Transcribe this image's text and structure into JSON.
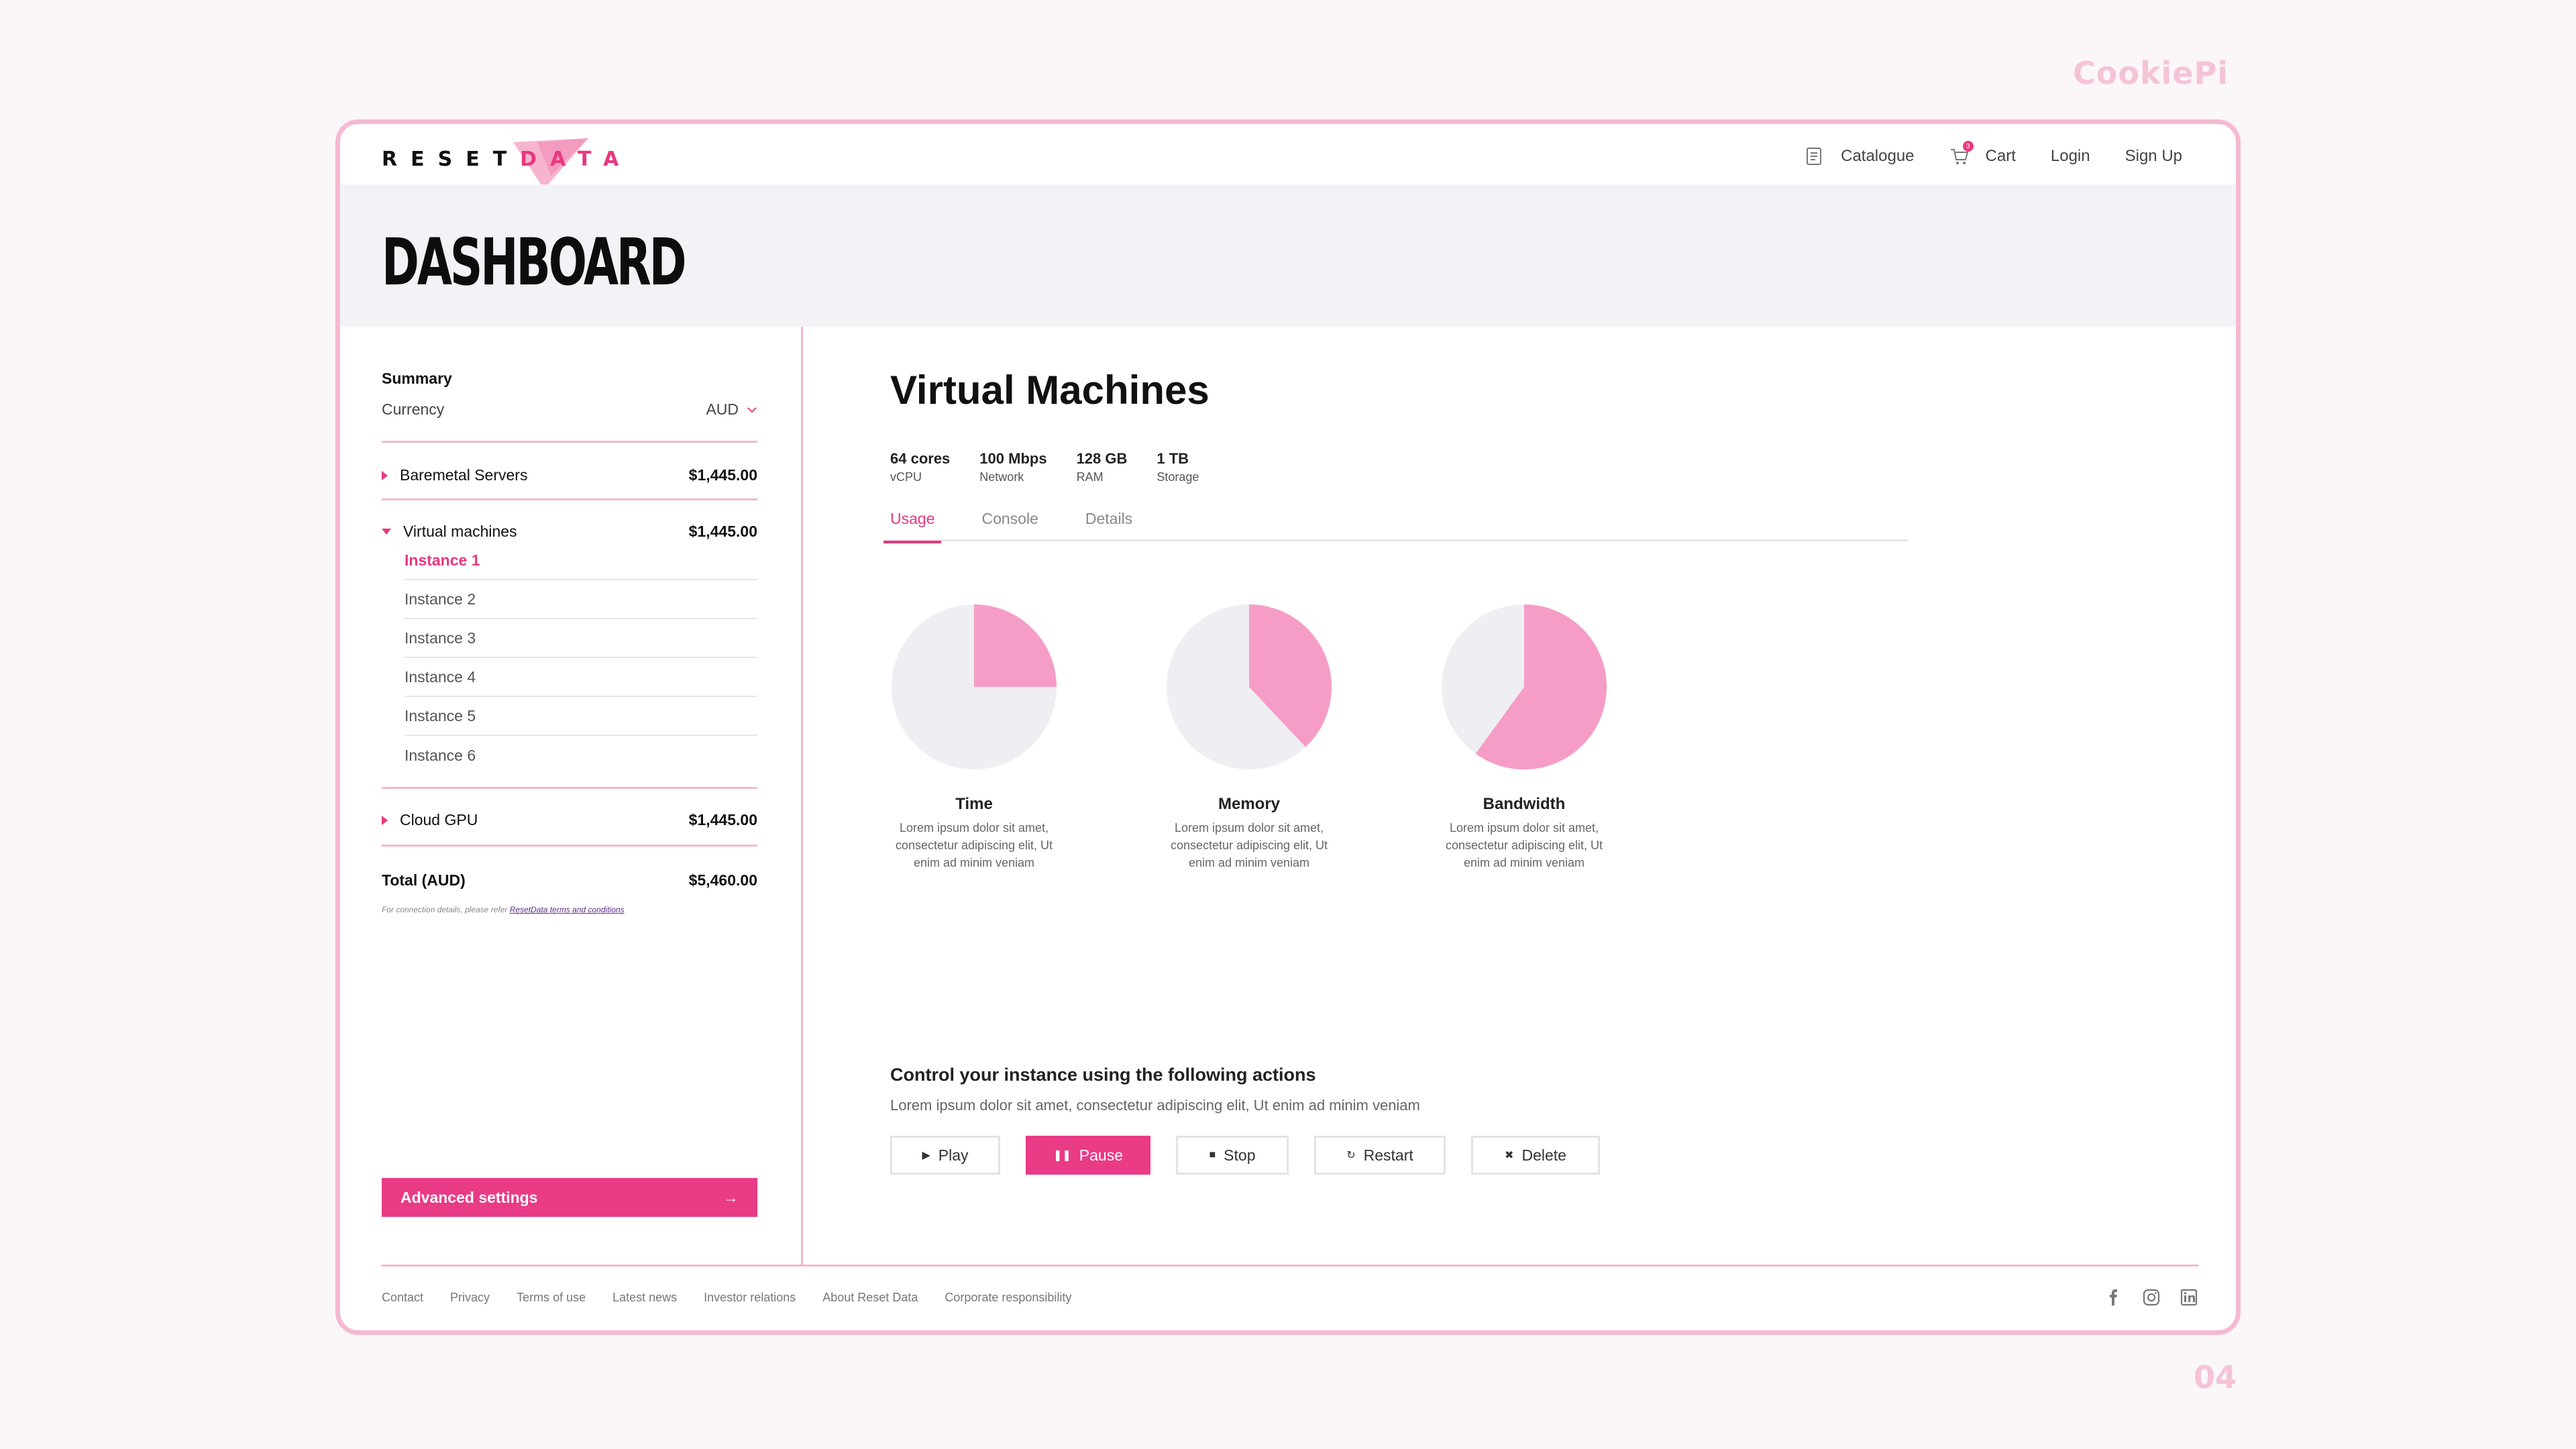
{
  "corner_brand": "CookiePi",
  "page_number": "04",
  "logo": {
    "part1": "RESET",
    "part2": "DATA"
  },
  "nav": {
    "catalogue": "Catalogue",
    "cart": "Cart",
    "cart_count": "3",
    "login": "Login",
    "signup": "Sign Up"
  },
  "header": {
    "title": "DASHBOARD"
  },
  "sidebar": {
    "summary": "Summary",
    "currency_label": "Currency",
    "currency_value": "AUD",
    "groups": [
      {
        "label": "Baremetal Servers",
        "amount": "$1,445.00",
        "expanded": false
      },
      {
        "label": "Virtual machines",
        "amount": "$1,445.00",
        "expanded": true
      },
      {
        "label": "Cloud GPU",
        "amount": "$1,445.00",
        "expanded": false
      }
    ],
    "instances": [
      "Instance 1",
      "Instance 2",
      "Instance 3",
      "Instance 4",
      "Instance 5",
      "Instance 6"
    ],
    "active_instance": "Instance 1",
    "total_label": "Total (AUD)",
    "total_value": "$5,460.00",
    "note_text": "For connection details, please refer",
    "note_link": "ResetData terms and conditions",
    "advanced_settings": "Advanced settings"
  },
  "main": {
    "title": "Virtual Machines",
    "specs": [
      {
        "value": "64 cores",
        "label": "vCPU"
      },
      {
        "value": "100 Mbps",
        "label": "Network"
      },
      {
        "value": "128 GB",
        "label": "RAM"
      },
      {
        "value": "1 TB",
        "label": "Storage"
      }
    ],
    "tabs": [
      "Usage",
      "Console",
      "Details"
    ],
    "active_tab": "Usage",
    "usage": [
      {
        "name": "Time",
        "fraction": 0.25,
        "desc1": "Lorem ipsum dolor sit amet,",
        "desc2": "consectetur adipiscing elit, Ut",
        "desc3": "enim ad minim veniam"
      },
      {
        "name": "Memory",
        "fraction": 0.38,
        "desc1": "Lorem ipsum dolor sit amet,",
        "desc2": "consectetur adipiscing elit, Ut",
        "desc3": "enim ad minim veniam"
      },
      {
        "name": "Bandwidth",
        "fraction": 0.6,
        "desc1": "Lorem ipsum dolor sit amet,",
        "desc2": "consectetur adipiscing elit, Ut",
        "desc3": "enim ad minim veniam"
      }
    ],
    "control_title": "Control your instance using the following actions",
    "control_sub": "Lorem ipsum dolor sit amet, consectetur adipiscing elit, Ut enim ad minim veniam",
    "actions": [
      {
        "label": "Play",
        "icon": "play-icon",
        "glyph": "▶",
        "primary": false
      },
      {
        "label": "Pause",
        "icon": "pause-icon",
        "glyph": "❚❚",
        "primary": true
      },
      {
        "label": "Stop",
        "icon": "stop-icon",
        "glyph": "■",
        "primary": false
      },
      {
        "label": "Restart",
        "icon": "restart-icon",
        "glyph": "↻",
        "primary": false
      },
      {
        "label": "Delete",
        "icon": "delete-icon",
        "glyph": "✖",
        "primary": false
      }
    ]
  },
  "footer": {
    "links": [
      "Contact",
      "Privacy",
      "Terms of use",
      "Latest news",
      "Investor relations",
      "About Reset Data",
      "Corporate responsibility"
    ],
    "socials": [
      "facebook-icon",
      "instagram-icon",
      "linkedin-icon"
    ]
  },
  "colors": {
    "accent": "#e8387f",
    "pie_fill": "#f59dc6",
    "pie_bg": "#efeef2",
    "frame_border": "#f5b9d2"
  }
}
